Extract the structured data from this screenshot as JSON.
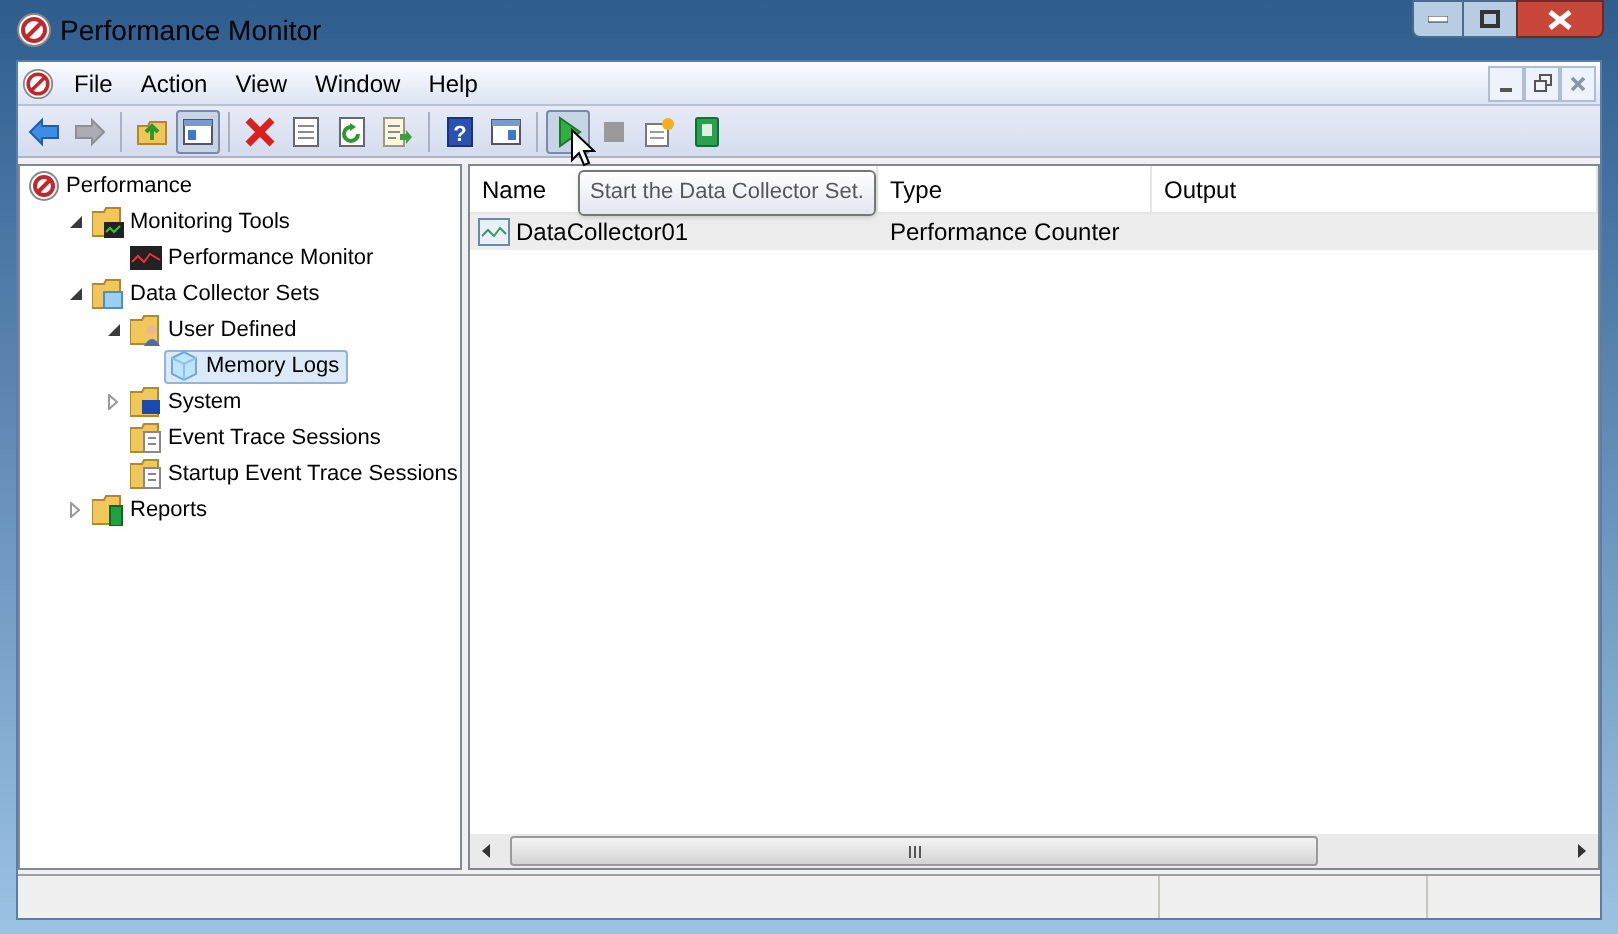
{
  "window": {
    "title": "Performance Monitor"
  },
  "menu": [
    {
      "label": "File"
    },
    {
      "label": "Action"
    },
    {
      "label": "View"
    },
    {
      "label": "Window"
    },
    {
      "label": "Help"
    }
  ],
  "toolbar": [
    {
      "kind": "back",
      "pressed": false,
      "disabled": false
    },
    {
      "kind": "forward",
      "pressed": false,
      "disabled": true
    },
    {
      "kind": "separator"
    },
    {
      "kind": "up",
      "pressed": false,
      "disabled": false
    },
    {
      "kind": "tree",
      "pressed": true,
      "disabled": false
    },
    {
      "kind": "separator"
    },
    {
      "kind": "delete",
      "pressed": false,
      "disabled": false
    },
    {
      "kind": "properties",
      "pressed": false,
      "disabled": false
    },
    {
      "kind": "refresh",
      "pressed": false,
      "disabled": false
    },
    {
      "kind": "export",
      "pressed": false,
      "disabled": false
    },
    {
      "kind": "separator"
    },
    {
      "kind": "help",
      "glyph": "?",
      "pressed": false,
      "disabled": false
    },
    {
      "kind": "panel",
      "pressed": false,
      "disabled": false
    },
    {
      "kind": "separator"
    },
    {
      "kind": "start",
      "pressed": true,
      "disabled": false
    },
    {
      "kind": "stop",
      "pressed": false,
      "disabled": true
    },
    {
      "kind": "new",
      "pressed": false,
      "disabled": false
    },
    {
      "kind": "report",
      "pressed": false,
      "disabled": false
    }
  ],
  "tooltip": "Start the Data Collector Set.",
  "tree": [
    {
      "label": "Performance",
      "kind": "root",
      "selected": false,
      "children": [
        {
          "label": "Monitoring Tools",
          "kind": "folder-chart",
          "expanded": true,
          "selected": false,
          "children": [
            {
              "label": "Performance Monitor",
              "kind": "monitor",
              "selected": false
            }
          ]
        },
        {
          "label": "Data Collector Sets",
          "kind": "folder-sets",
          "expanded": true,
          "selected": false,
          "children": [
            {
              "label": "User Defined",
              "kind": "folder-user",
              "expanded": true,
              "selected": false,
              "children": [
                {
                  "label": "Memory Logs",
                  "kind": "cube",
                  "selected": true
                }
              ]
            },
            {
              "label": "System",
              "kind": "folder-system",
              "expanded": false,
              "selected": false
            },
            {
              "label": "Event Trace Sessions",
              "kind": "folder-trace",
              "selected": false
            },
            {
              "label": "Startup Event Trace Sessions",
              "kind": "folder-trace",
              "selected": false
            }
          ]
        },
        {
          "label": "Reports",
          "kind": "folder-report",
          "expanded": false,
          "selected": false
        }
      ]
    }
  ],
  "table": {
    "columns": [
      "Name",
      "Type",
      "Output"
    ],
    "rows": [
      {
        "name": "DataCollector01",
        "type": "Performance Counter",
        "selected": true
      }
    ]
  }
}
